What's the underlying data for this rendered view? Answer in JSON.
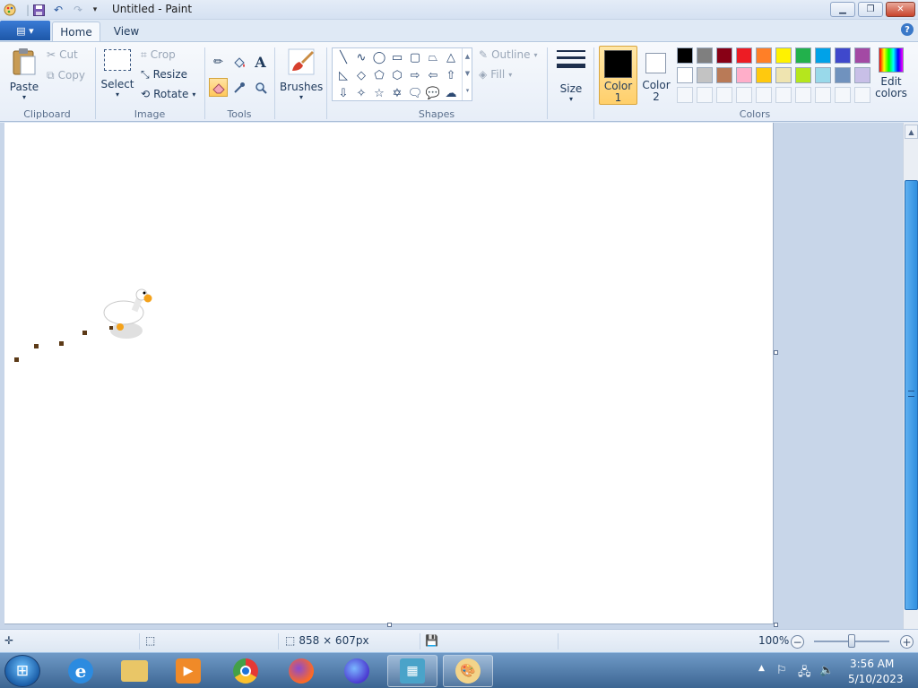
{
  "window": {
    "title": "Untitled - Paint",
    "qat_icons": [
      "paint-app-icon",
      "save-icon",
      "undo-icon",
      "redo-icon",
      "customize-dropdown-icon"
    ],
    "controls": [
      "minimize",
      "restore",
      "close"
    ]
  },
  "tabs": {
    "home": "Home",
    "view": "View"
  },
  "ribbon": {
    "clipboard": {
      "label": "Clipboard",
      "paste": "Paste",
      "cut": "Cut",
      "copy": "Copy"
    },
    "image": {
      "label": "Image",
      "select": "Select",
      "crop": "Crop",
      "resize": "Resize",
      "rotate": "Rotate"
    },
    "tools": {
      "label": "Tools",
      "items": [
        "pencil",
        "fill",
        "text",
        "eraser",
        "color-picker",
        "magnifier"
      ],
      "active": "eraser"
    },
    "brushes": {
      "label": "Brushes"
    },
    "shapes": {
      "label": "Shapes",
      "outline": "Outline",
      "fill": "Fill"
    },
    "size": {
      "label": "Size"
    },
    "colors": {
      "label": "Colors",
      "color1": "Color\n1",
      "color1_line1": "Color",
      "color1_line2": "1",
      "color2_line1": "Color",
      "color2_line2": "2",
      "edit": "Edit colors",
      "edit_line1": "Edit",
      "edit_line2": "colors",
      "color1_value": "#000000",
      "color2_value": "#ffffff",
      "palette_row1": [
        "#000000",
        "#7f7f7f",
        "#880015",
        "#ed1c24",
        "#ff7f27",
        "#fff200",
        "#22b14c",
        "#00a2e8",
        "#3f48cc",
        "#a349a4"
      ],
      "palette_row2": [
        "#ffffff",
        "#c3c3c3",
        "#b97a57",
        "#ffaec9",
        "#ffc90e",
        "#efe4b0",
        "#b5e61d",
        "#99d9ea",
        "#7092be",
        "#c8bfe7"
      ]
    }
  },
  "canvas": {
    "dimensions": "858 × 607px"
  },
  "statusbar": {
    "zoom": "100%"
  },
  "taskbar": {
    "apps": [
      "internet-explorer",
      "file-explorer",
      "media-player",
      "chrome",
      "firefox",
      "firefox-nightly",
      "app-installer",
      "paint"
    ],
    "time": "3:56 AM",
    "date": "5/10/2023"
  }
}
